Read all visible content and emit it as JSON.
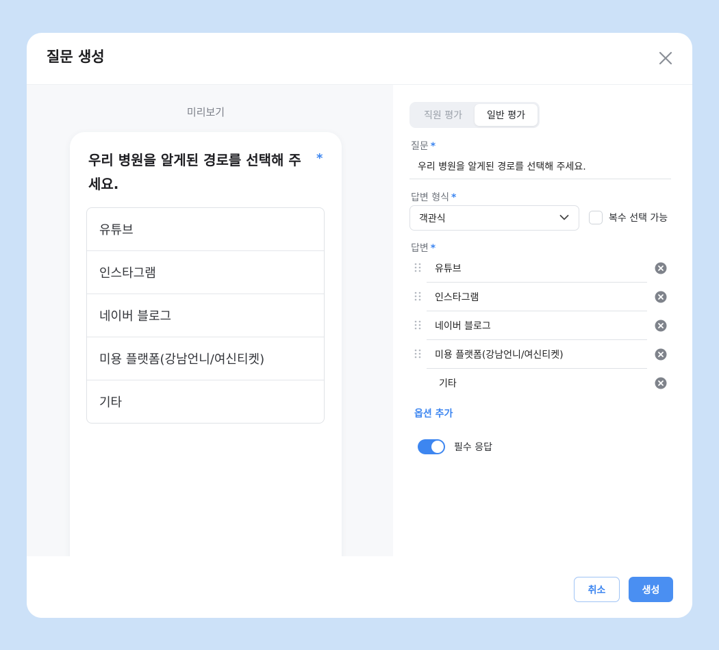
{
  "modal": {
    "title": "질문 생성"
  },
  "preview": {
    "label": "미리보기",
    "question": "우리 병원을 알게된 경로를 선택해 주세요.",
    "required_mark": "*",
    "options": [
      "유튜브",
      "인스타그램",
      "네이버 블로그",
      "미용 플랫폼(강남언니/여신티켓)",
      "기타"
    ]
  },
  "form": {
    "tabs": [
      {
        "label": "직원 평가",
        "active": false
      },
      {
        "label": "일반 평가",
        "active": true
      }
    ],
    "question_label": "질문",
    "question_value": "우리 병원을 알게된 경로를 선택해 주세요.",
    "answer_type_label": "답변 형식",
    "answer_type_value": "객관식",
    "multi_select_label": "복수 선택 가능",
    "multi_select_checked": false,
    "answers_label": "답변",
    "required_mark": "*",
    "answers": [
      "유튜브",
      "인스타그램",
      "네이버 블로그",
      "미용 플랫폼(강남언니/여신티켓)",
      "기타"
    ],
    "add_option_label": "옵션 추가",
    "required_toggle_label": "필수 응답",
    "required_toggle_on": true
  },
  "footer": {
    "cancel_label": "취소",
    "create_label": "생성"
  },
  "colors": {
    "accent": "#3d86f0",
    "background": "#cce1f8"
  },
  "icons": {
    "close": "close-icon",
    "chevron": "chevron-down-icon",
    "drag": "drag-handle-icon",
    "remove": "remove-circle-icon"
  }
}
